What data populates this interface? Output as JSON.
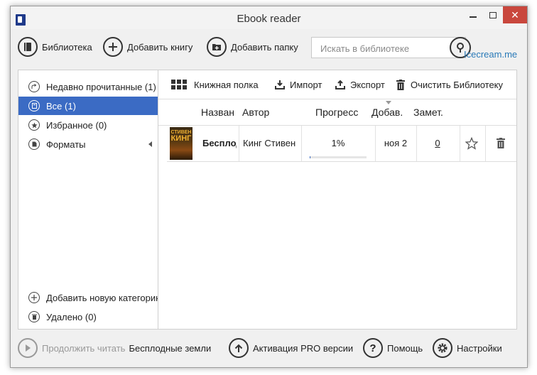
{
  "window": {
    "title": "Ebook reader"
  },
  "toolbar": {
    "library": "Библиотека",
    "add_book": "Добавить книгу",
    "add_folder": "Добавить папку",
    "search_placeholder": "Искать в библиотеке",
    "brand_link": "Icecream.me"
  },
  "sidebar": {
    "items": [
      {
        "label": "Недавно прочитанные (1)",
        "icon": "share-icon"
      },
      {
        "label": "Все (1)",
        "icon": "book-icon",
        "active": true
      },
      {
        "label": "Избранное (0)",
        "icon": "star-icon"
      },
      {
        "label": "Форматы",
        "icon": "file-icon"
      }
    ],
    "add_category": "Добавить новую категорию",
    "deleted": "Удалено (0)"
  },
  "main": {
    "tools": {
      "bookshelf": "Книжная полка",
      "import": "Импорт",
      "export": "Экспорт",
      "clear": "Очистить Библиотеку"
    },
    "columns": [
      "Название",
      "Автор",
      "Прогресс",
      "Добав.",
      "Замет."
    ],
    "rows": [
      {
        "cover_text_top": "СТИВЕН",
        "cover_text_main": "КИНГ",
        "title": "Бесплодные земли",
        "author": "Кинг Стивен",
        "progress": "1%",
        "progress_value": 0.01,
        "added": "ноя 2",
        "notes": "0"
      }
    ]
  },
  "bottom": {
    "continue_label": "Продолжить читать",
    "continue_book": "Бесплодные земли",
    "activate": "Активация PRO версии",
    "help": "Помощь",
    "settings": "Настройки"
  },
  "colors": {
    "accent": "#3b6bc4",
    "close": "#c9473d",
    "link": "#2a7ab8"
  }
}
